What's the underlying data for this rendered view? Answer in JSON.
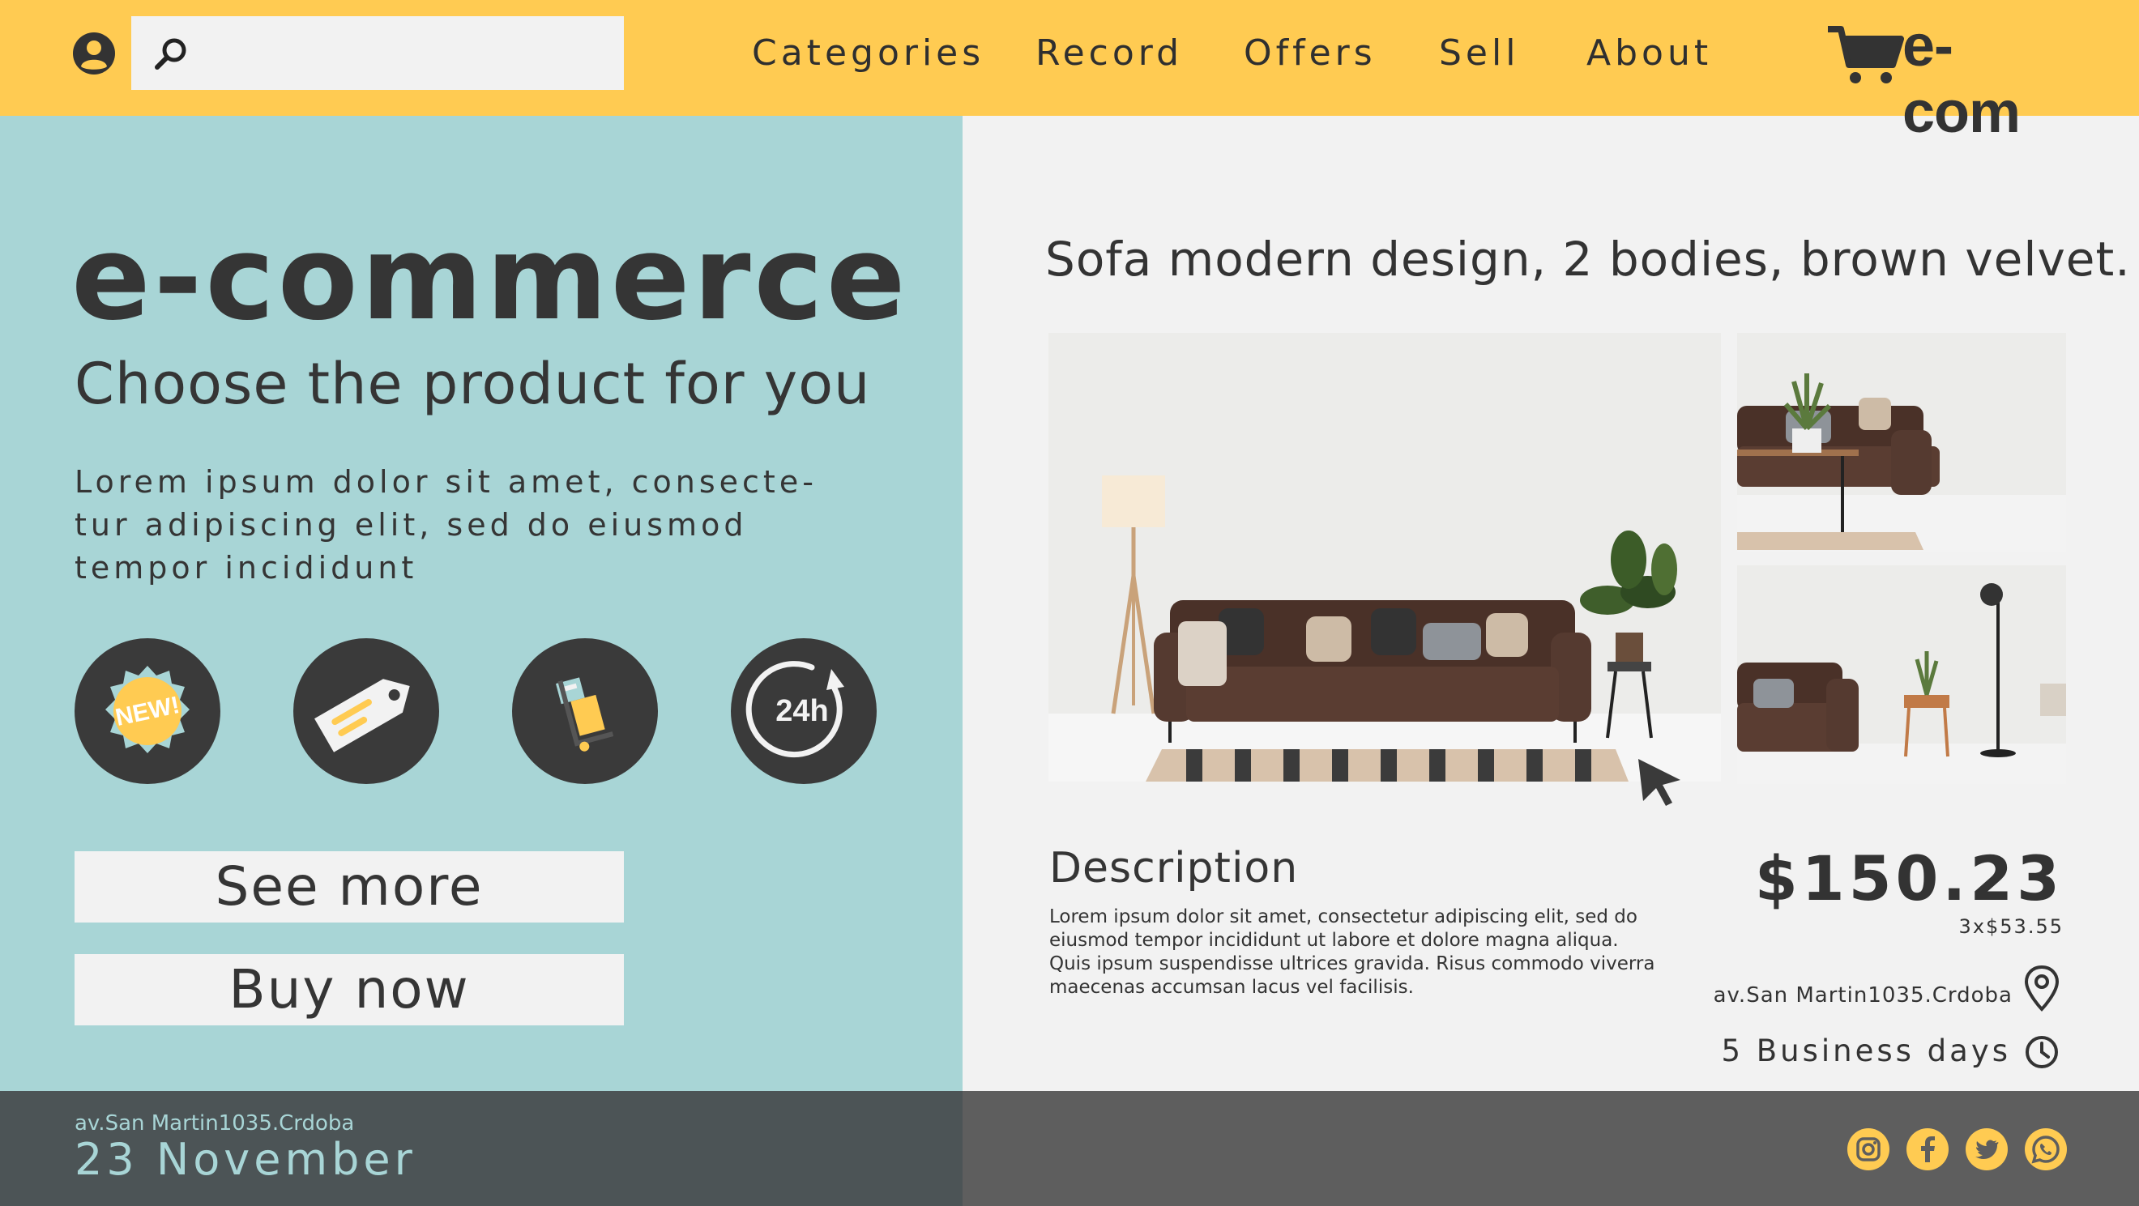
{
  "header": {
    "search": {
      "placeholder": "",
      "value": ""
    },
    "nav": [
      "Categories",
      "Record",
      "Offers",
      "Sell",
      "About"
    ],
    "logo_text": "e-com"
  },
  "hero": {
    "title": "e-commerce",
    "subtitle": "Choose the product for you",
    "body": "Lorem ipsum dolor sit amet, consecte-tur adipiscing elit, sed do eiusmod tempor incididunt",
    "features": [
      {
        "icon": "new-badge-icon",
        "label": "NEW!"
      },
      {
        "icon": "price-tag-icon"
      },
      {
        "icon": "delivery-cart-icon"
      },
      {
        "icon": "24h-icon",
        "label": "24h"
      }
    ],
    "see_more": "See more",
    "buy_now": "Buy now"
  },
  "product": {
    "title": "Sofa modern design, 2 bodies, brown velvet.",
    "description_title": "Description",
    "description": "Lorem ipsum dolor sit amet, consectetur adipiscing elit, sed do eiusmod tempor incididunt ut labore et dolore magna aliqua. Quis ipsum suspendisse ultrices gravida. Risus commodo viverra maecenas accumsan lacus vel facilisis.",
    "price": "$150.23",
    "installments": "3x$53.55",
    "address": "av.San Martin1035.Crdoba",
    "delivery": "5 Business days"
  },
  "footer": {
    "address": "av.San Martin1035.Crdoba",
    "date": "23 November",
    "social": [
      "instagram-icon",
      "facebook-icon",
      "twitter-icon",
      "whatsapp-icon"
    ]
  },
  "colors": {
    "header": "#ffcb52",
    "left_panel": "#a8d5d6",
    "right_panel": "#f2f2f2",
    "footer_left": "#4c5456",
    "footer_right": "#5e5e5e",
    "text": "#353535"
  }
}
